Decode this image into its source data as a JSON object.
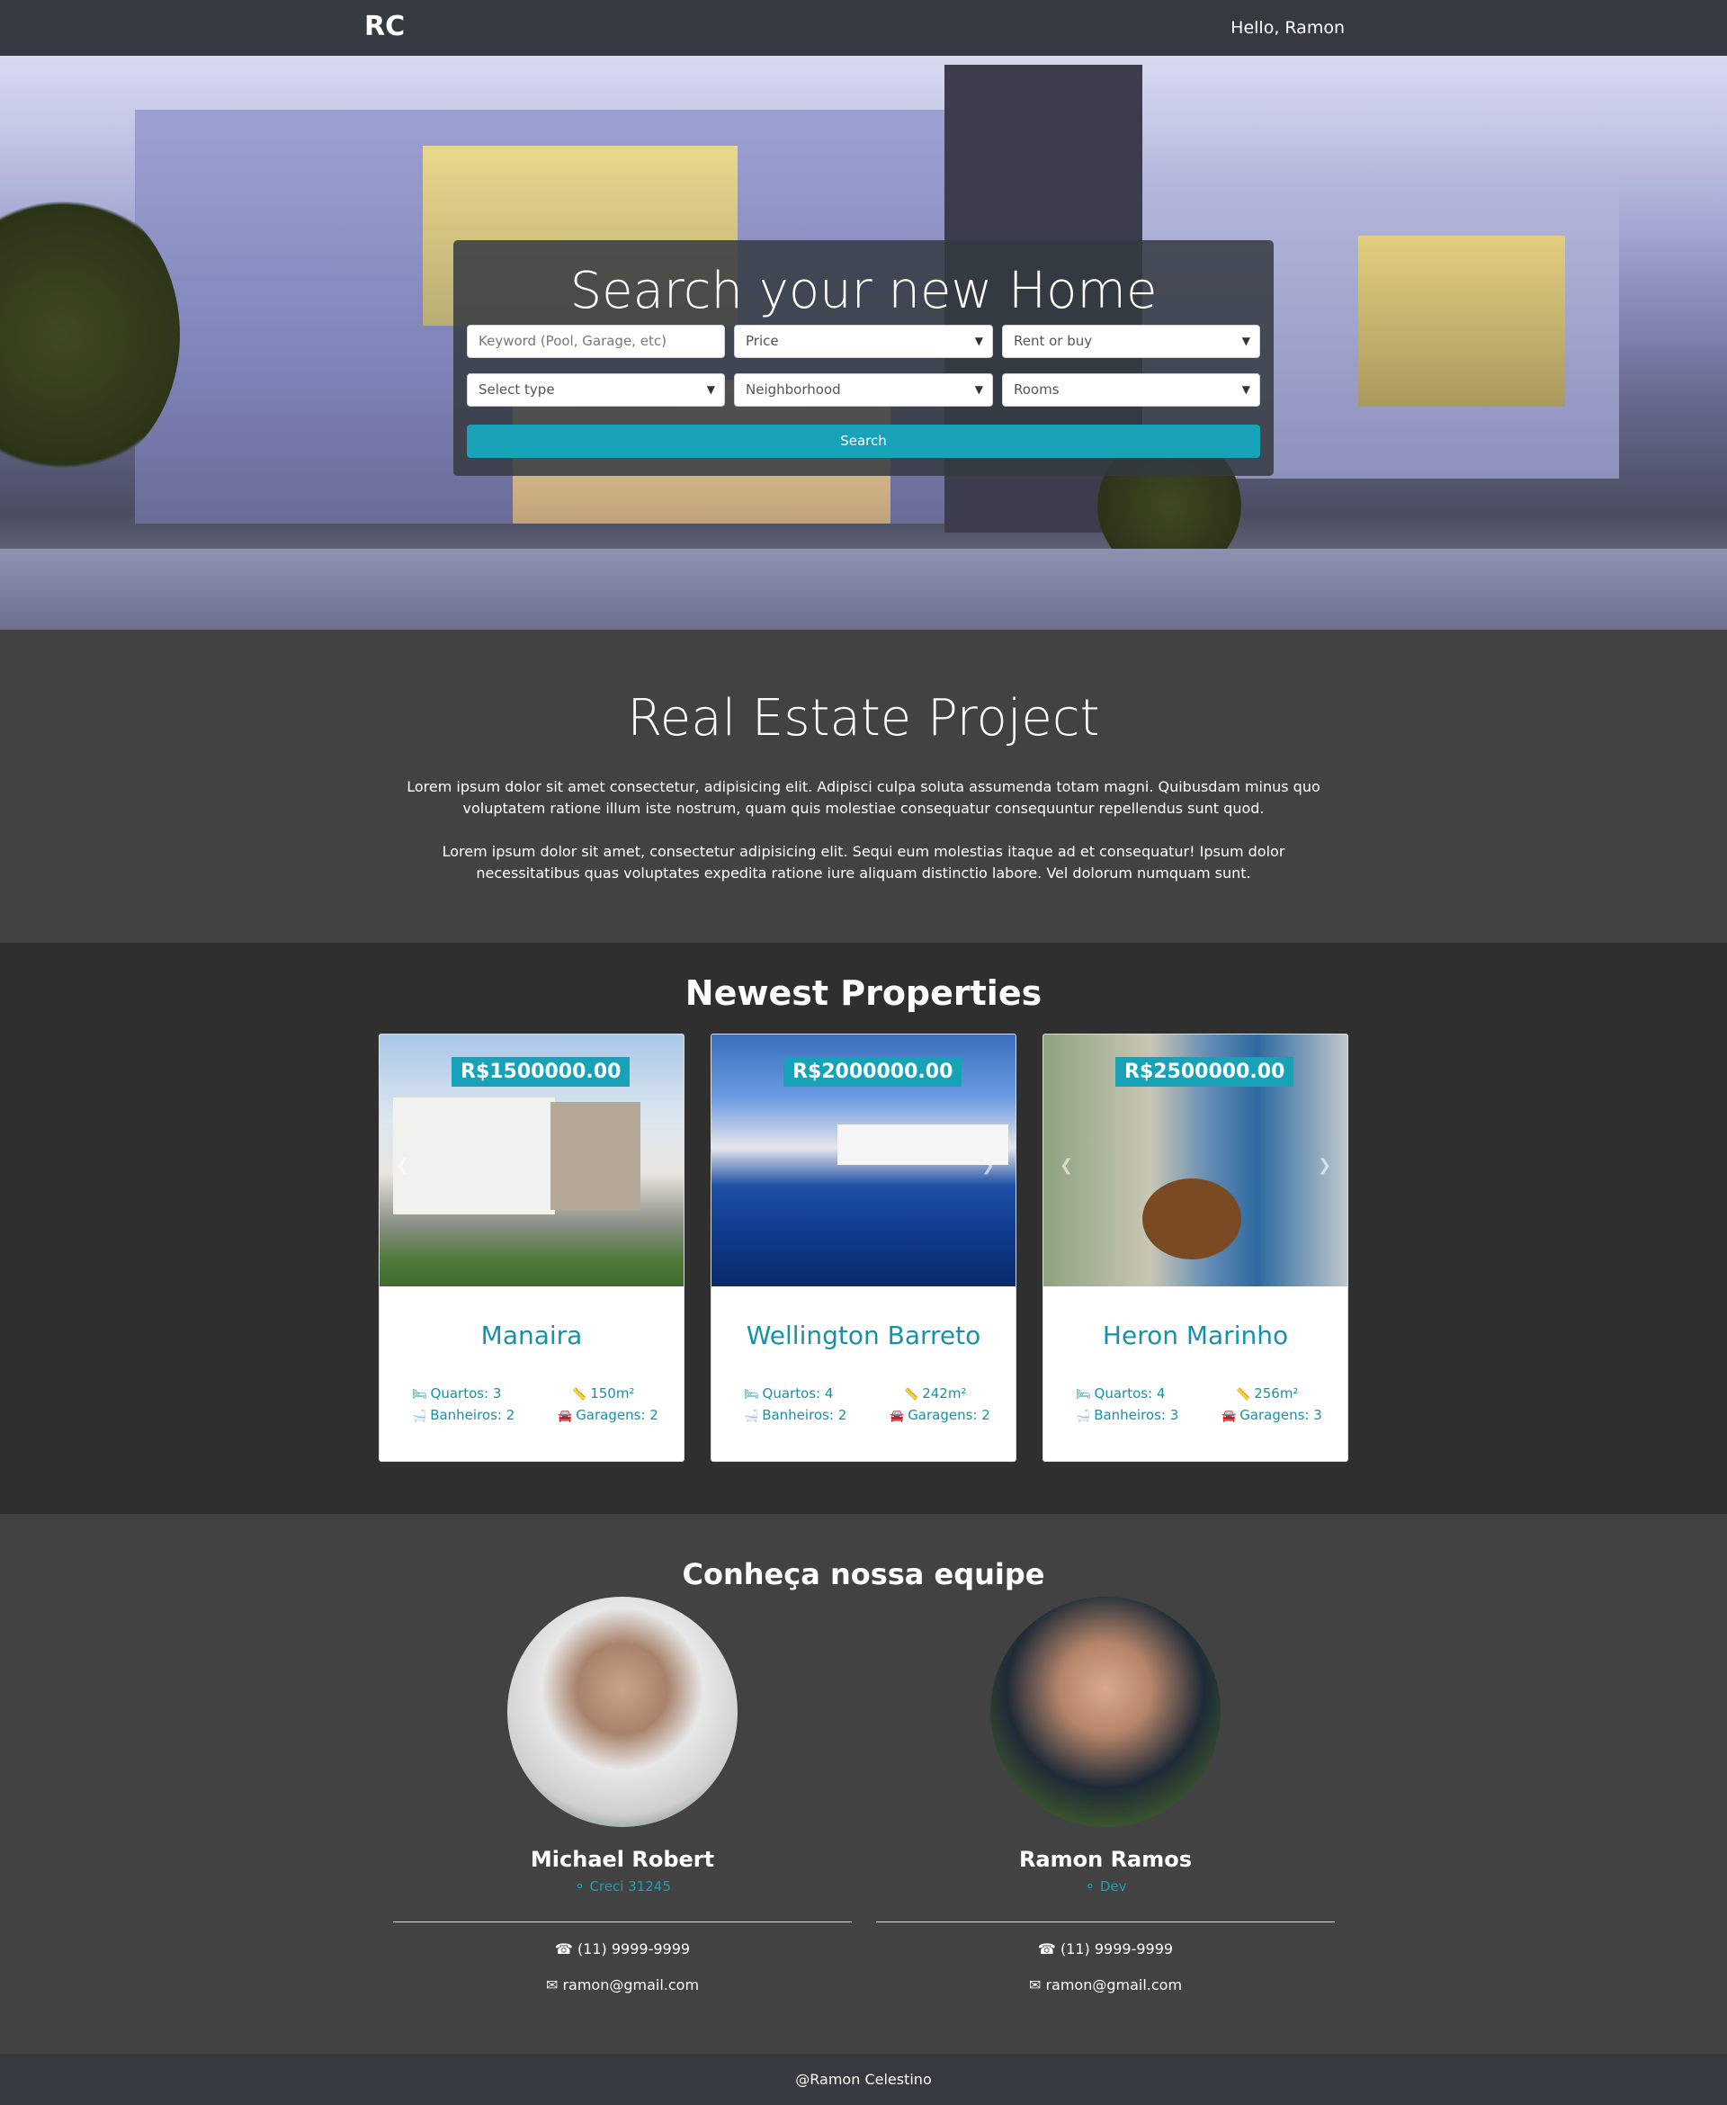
{
  "navbar": {
    "brand": "RC",
    "greeting": "Hello, Ramon"
  },
  "hero": {
    "title": "Search your new Home",
    "keyword_placeholder": "Keyword (Pool, Garage, etc)",
    "price": "Price",
    "rent_or_buy": "Rent or buy",
    "type": "Select type",
    "neighborhood": "Neighborhood",
    "rooms": "Rooms",
    "search_button": "Search"
  },
  "about": {
    "title": "Real Estate Project",
    "p1": "Lorem ipsum dolor sit amet consectetur, adipisicing elit. Adipisci culpa soluta assumenda totam magni. Quibusdam minus quo voluptatem ratione illum iste nostrum, quam quis molestiae consequatur consequuntur repellendus sunt quod.",
    "p2": "Lorem ipsum dolor sit amet, consectetur adipisicing elit. Sequi eum molestias itaque ad et consequatur! Ipsum dolor necessitatibus quas voluptates expedita ratione iure aliquam distinctio labore. Vel dolorum numquam sunt."
  },
  "properties": {
    "title": "Newest Properties",
    "items": [
      {
        "price": "R$1500000.00",
        "name": "Manaira",
        "rooms": "Quartos: 3",
        "area": "150m²",
        "baths": "Banheiros: 2",
        "garages": "Garagens: 2"
      },
      {
        "price": "R$2000000.00",
        "name": "Wellington Barreto",
        "rooms": "Quartos: 4",
        "area": "242m²",
        "baths": "Banheiros: 2",
        "garages": "Garagens: 2"
      },
      {
        "price": "R$2500000.00",
        "name": "Heron Marinho",
        "rooms": "Quartos: 4",
        "area": "256m²",
        "baths": "Banheiros: 3",
        "garages": "Garagens: 3"
      }
    ]
  },
  "team": {
    "title": "Conheça nossa equipe",
    "members": [
      {
        "name": "Michael Robert",
        "role": "Creci 31245",
        "phone": "(11) 9999-9999",
        "email": "ramon@gmail.com"
      },
      {
        "name": "Ramon Ramos",
        "role": "Dev",
        "phone": "(11) 9999-9999",
        "email": "ramon@gmail.com"
      }
    ]
  },
  "footer": {
    "text": "@Ramon Celestino"
  },
  "colors": {
    "accent": "#17a2b8",
    "navbar": "#343a40",
    "section_dark": "#2f2f2f",
    "section_mid": "#424242"
  }
}
